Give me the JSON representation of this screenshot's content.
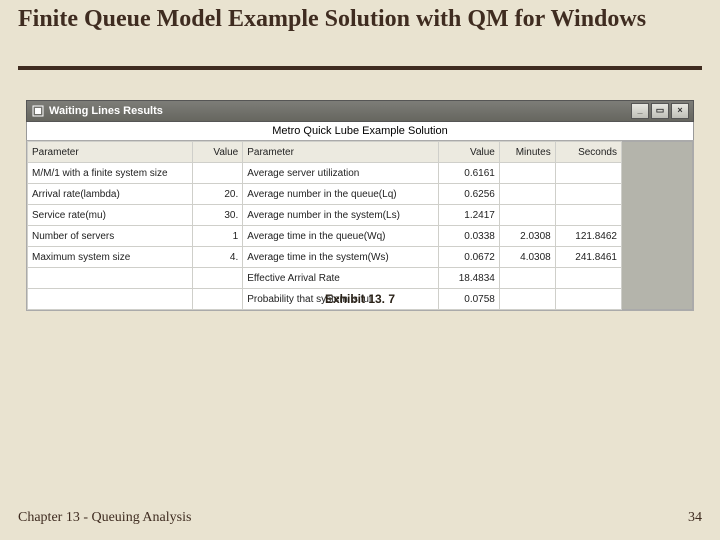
{
  "slide": {
    "title": "Finite Queue Model Example Solution with QM for Windows",
    "caption": "Exhibit 13. 7",
    "footer_left": "Chapter 13 - Queuing Analysis",
    "footer_right": "34"
  },
  "window": {
    "title": "Waiting Lines Results",
    "icon_label": "window-icon",
    "buttons": {
      "min": "_",
      "max": "▭",
      "close": "×"
    },
    "subtitle": "Metro Quick Lube Example Solution",
    "headers": {
      "param_left": "Parameter",
      "value_left": "Value",
      "param_right": "Parameter",
      "value_right": "Value",
      "minutes": "Minutes",
      "seconds": "Seconds"
    },
    "rows": [
      {
        "pl": "M/M/1 with a finite system size",
        "vl": "",
        "pr": "Average server utilization",
        "vr": "0.6161",
        "min": "",
        "sec": ""
      },
      {
        "pl": "Arrival rate(lambda)",
        "vl": "20.",
        "pr": "Average number in the queue(Lq)",
        "vr": "0.6256",
        "min": "",
        "sec": ""
      },
      {
        "pl": "Service rate(mu)",
        "vl": "30.",
        "pr": "Average number in the system(Ls)",
        "vr": "1.2417",
        "min": "",
        "sec": ""
      },
      {
        "pl": "Number of servers",
        "vl": "1",
        "pr": "Average time in the queue(Wq)",
        "vr": "0.0338",
        "min": "2.0308",
        "sec": "121.8462"
      },
      {
        "pl": "Maximum system size",
        "vl": "4.",
        "pr": "Average time in the system(Ws)",
        "vr": "0.0672",
        "min": "4.0308",
        "sec": "241.8461"
      },
      {
        "pl": "",
        "vl": "",
        "pr": "Effective Arrival Rate",
        "vr": "18.4834",
        "min": "",
        "sec": ""
      },
      {
        "pl": "",
        "vl": "",
        "pr": "Probability that system is full",
        "vr": "0.0758",
        "min": "",
        "sec": ""
      }
    ]
  }
}
